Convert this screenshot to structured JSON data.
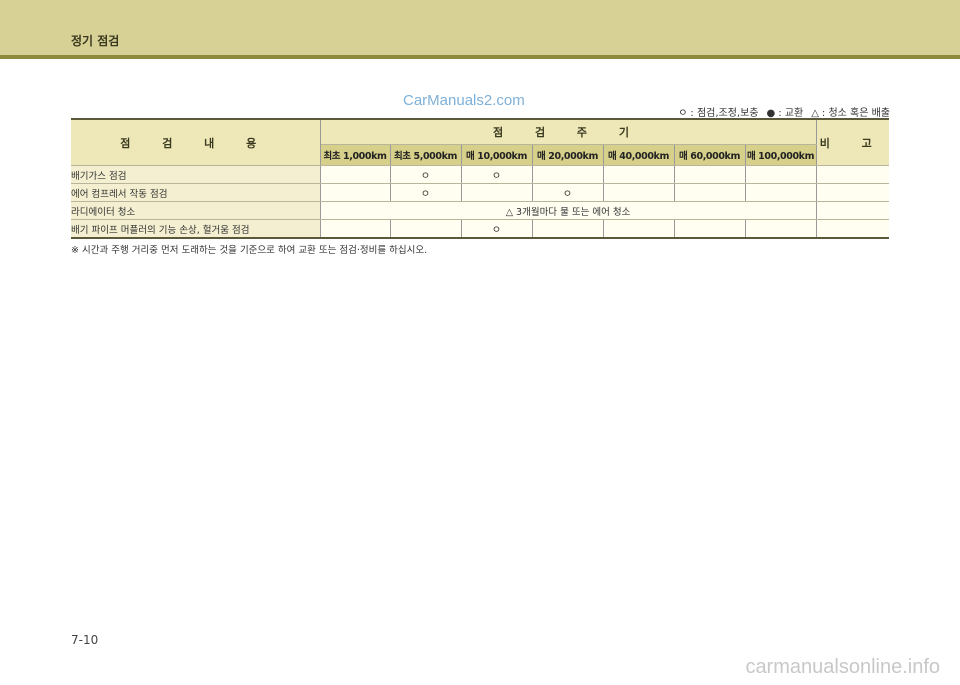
{
  "header": {
    "title": "정기 점검"
  },
  "watermark_top": "CarManuals2.com",
  "legend": {
    "items": [
      {
        "symbol": "ㅇ",
        "label": ": 점검,조정,보충"
      },
      {
        "symbol": "●",
        "label": ": 교환"
      },
      {
        "symbol": "△",
        "label": ": 청소 혹은 배출"
      }
    ]
  },
  "table": {
    "col_item_header": "점 검 내 용",
    "col_period_header": "점 검 주 기",
    "col_remarks_header": "비 고",
    "intervals": [
      "최초 1,000km",
      "최초 5,000km",
      "매 10,000km",
      "매 20,000km",
      "매 40,000km",
      "매 60,000km",
      "매 100,000km"
    ],
    "rows": [
      {
        "item": "배기가스 점검",
        "marks": [
          "",
          "ㅇ",
          "ㅇ",
          "",
          "",
          "",
          ""
        ],
        "remarks": ""
      },
      {
        "item": "에어 컴프레서 작동 점검",
        "marks": [
          "",
          "ㅇ",
          "",
          "ㅇ",
          "",
          "",
          ""
        ],
        "remarks": ""
      },
      {
        "item": "라디에이터 청소",
        "span_note": "△ 3개월마다 물 또는 에어 청소",
        "remarks": ""
      },
      {
        "item": "배기 파이프 머플러의 기능 손상, 헐거움 점검",
        "marks": [
          "",
          "",
          "ㅇ",
          "",
          "",
          "",
          ""
        ],
        "remarks": ""
      }
    ]
  },
  "footnote": "※ 시간과 주행 거리중 먼저 도래하는 것을 기준으로 하여 교환 또는 점검·정비를 하십시오.",
  "page_number": "7-10",
  "watermark_bottom": "carmanualsonline.info"
}
